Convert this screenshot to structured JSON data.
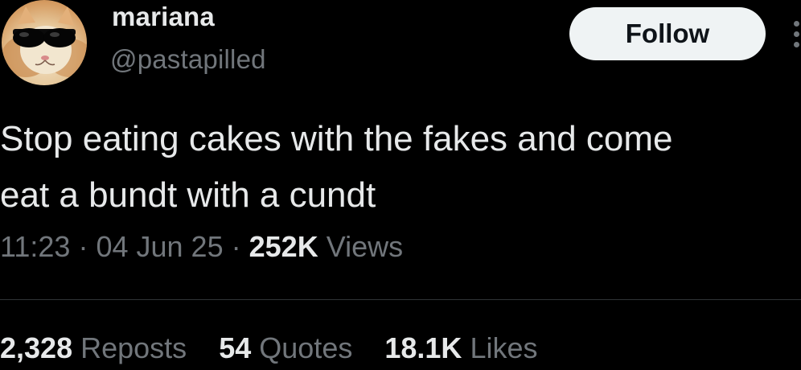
{
  "author": {
    "display_name": "mariana",
    "handle": "@pastapilled",
    "avatar": "cat-with-sunglasses"
  },
  "follow_button": {
    "label": "Follow"
  },
  "more_menu": {
    "icon": "more-dots-icon"
  },
  "tweet": {
    "text": "Stop eating cakes with the fakes and come\neat a bundt with a cundt"
  },
  "meta": {
    "time": "11:23",
    "separator": "·",
    "date": "04 Jun 25",
    "views_count": "252K",
    "views_label": "Views"
  },
  "stats": {
    "reposts_count": "2,328",
    "reposts_label": "Reposts",
    "quotes_count": "54",
    "quotes_label": "Quotes",
    "likes_count": "18.1K",
    "likes_label": "Likes"
  },
  "colors": {
    "background": "#000000",
    "primary_text": "#e7e9ea",
    "secondary_text": "#71767b",
    "button_bg": "#eff3f4",
    "divider": "#2f3336"
  }
}
